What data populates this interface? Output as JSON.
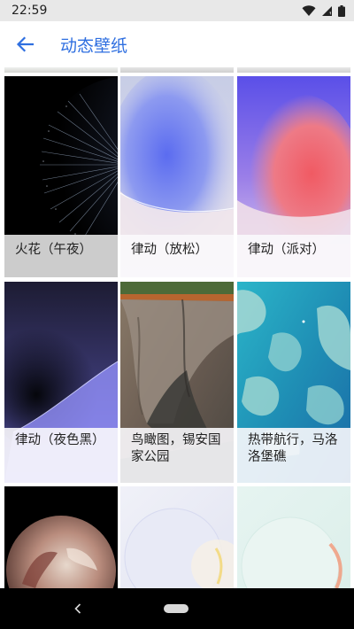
{
  "status": {
    "time": "22:59"
  },
  "header": {
    "title": "动态壁纸"
  },
  "wallpapers": [
    {
      "label": "火花（午夜）"
    },
    {
      "label": "律动（放松）"
    },
    {
      "label": "律动（派对）"
    },
    {
      "label": "律动（夜色黑）"
    },
    {
      "label": "鸟瞰图，锡安国家公园"
    },
    {
      "label": "热带航行，马洛洛堡礁"
    }
  ],
  "colors": {
    "accent": "#2f6fe0",
    "status_bar": "#e8e8e8",
    "nav_bar": "#000000"
  }
}
